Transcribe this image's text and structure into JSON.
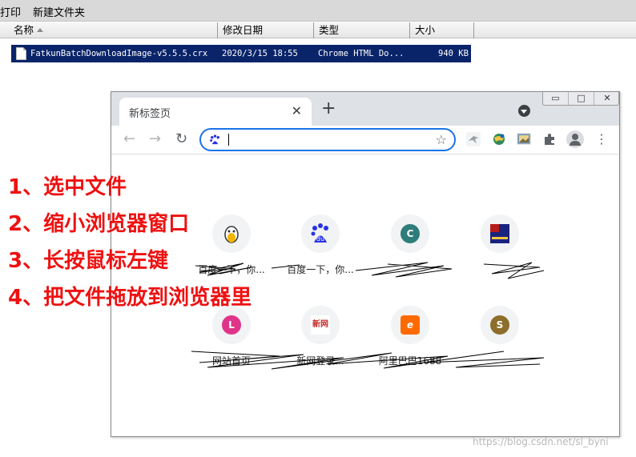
{
  "explorer": {
    "toolbar": {
      "print": "打印",
      "new_folder": "新建文件夹"
    },
    "columns": {
      "name": "名称",
      "modified": "修改日期",
      "type": "类型",
      "size": "大小"
    },
    "file": {
      "name": "FatkunBatchDownloadImage-v5.5.5.crx",
      "modified": "2020/3/15 18:55",
      "type": "Chrome HTML Do...",
      "size": "940 KB"
    }
  },
  "steps": [
    "1、选中文件",
    "2、缩小浏览器窗口",
    "3、长按鼠标左键",
    "4、把文件拖放到浏览器里"
  ],
  "browser": {
    "tab_title": "新标签页",
    "new_tab": "+",
    "close": "✕",
    "back": "←",
    "forward": "→",
    "reload": "↻",
    "star": "☆",
    "menu": "⋮",
    "window_controls": {
      "min": "▭",
      "max": "□",
      "close": "✕"
    },
    "icons": {
      "tab_search": "tab-search-icon",
      "omnibox_site": "baidu-icon",
      "extensions": [
        "bird-extension-icon",
        "globe-extension-icon",
        "image-extension-icon",
        "puzzle-extensions-icon"
      ],
      "profile": "profile-avatar-icon"
    }
  },
  "shortcuts": [
    {
      "label": "百度一下，你...",
      "letter": "",
      "color": "#f1f3f4",
      "icon": "qq-penguin-icon"
    },
    {
      "label": "百度一下，你...",
      "letter": "du",
      "color": "#2932e1",
      "icon": "baidu-paw-icon"
    },
    {
      "label": "",
      "letter": "C",
      "color": "#2e7d7a",
      "icon": "letter-c-icon"
    },
    {
      "label": "",
      "letter": "",
      "color": "#1a237e",
      "icon": "flag-thumbnail-icon"
    },
    {
      "label": "网站首页",
      "letter": "L",
      "color": "#e0348a",
      "icon": "letter-l-icon"
    },
    {
      "label": "新网登录...",
      "letter": "新网",
      "color": "#ffffff",
      "icon": "xinnet-icon"
    },
    {
      "label": "阿里巴巴1688",
      "letter": "e",
      "color": "#ff6a00",
      "icon": "alibaba-icon"
    },
    {
      "label": "",
      "letter": "S",
      "color": "#8d6e2a",
      "icon": "letter-s-icon"
    }
  ],
  "watermark": "https://blog.csdn.net/sl_byni"
}
